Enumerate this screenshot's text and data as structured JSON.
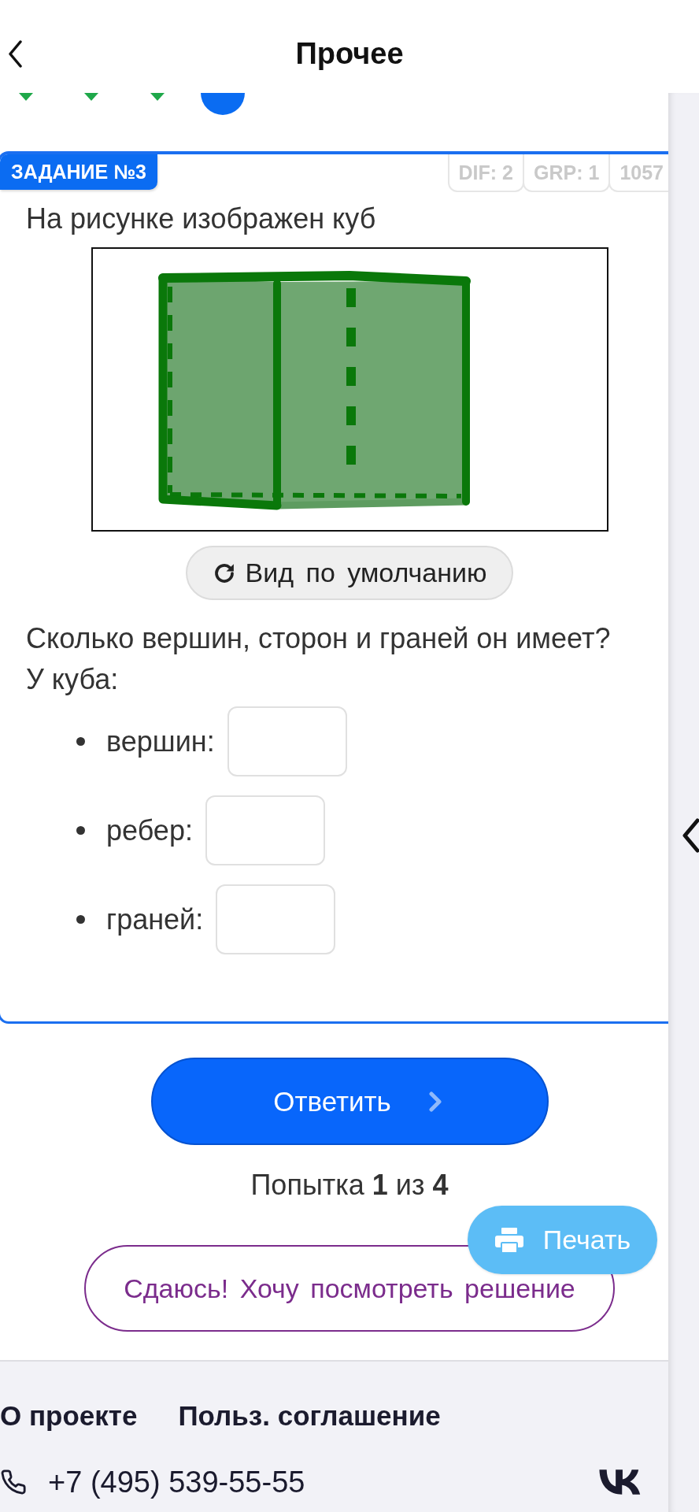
{
  "header": {
    "title": "Прочее"
  },
  "steps": [
    {
      "selected": false
    },
    {
      "selected": false
    },
    {
      "selected": false
    },
    {
      "selected": true
    }
  ],
  "task": {
    "badge": "ЗАДАНИЕ №3",
    "tags": [
      "DIF: 2",
      "GRP: 1",
      "1057"
    ],
    "intro": "На рисунке изображен куб",
    "reset_button": "Вид по умолчанию",
    "question": "Сколько вершин, сторон и граней он имеет?",
    "lead": "У куба:",
    "answers": [
      {
        "label": "вершин:"
      },
      {
        "label": "ребер:"
      },
      {
        "label": "граней:"
      }
    ]
  },
  "submit_button": "Ответить",
  "attempts": "Попытка **1** из **4**",
  "give_up_button": "Сдаюсь! Хочу посмотреть решение",
  "print_button": "Печать",
  "footer": {
    "links": [
      "О проекте",
      "Польз. соглашение"
    ],
    "phone": "+7 (495) 539-55-55"
  }
}
